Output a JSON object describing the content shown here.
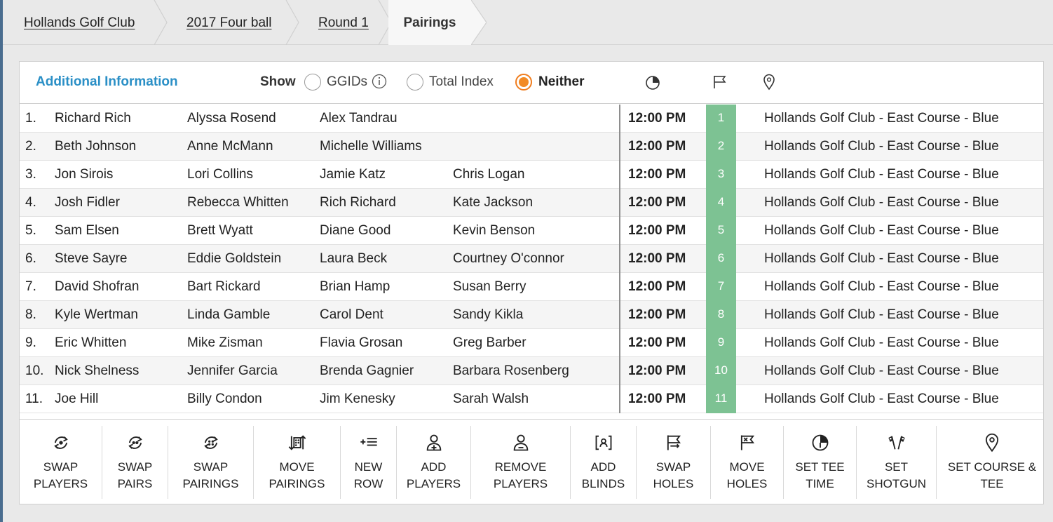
{
  "breadcrumb": [
    "Hollands Golf Club",
    "2017 Four ball",
    "Round 1",
    "Pairings"
  ],
  "info": {
    "title": "Additional Information",
    "show_label": "Show",
    "options": [
      "GGIDs",
      "Total Index",
      "Neither"
    ],
    "selected": "Neither"
  },
  "header_icons": [
    "clock-icon",
    "flag-icon",
    "location-pin-icon"
  ],
  "accent_colors": {
    "title": "#2a8fc6",
    "radio_selected": "#f28a24",
    "hole_cell": "#7dc293"
  },
  "rows": [
    {
      "num": "1.",
      "players": [
        "Richard Rich",
        "Alyssa Rosend",
        "Alex Tandrau",
        ""
      ],
      "time": "12:00 PM",
      "hole": "1",
      "course": "Hollands Golf Club - East Course - Blue"
    },
    {
      "num": "2.",
      "players": [
        "Beth Johnson",
        "Anne McMann",
        "Michelle Williams",
        ""
      ],
      "time": "12:00 PM",
      "hole": "2",
      "course": "Hollands Golf Club - East Course - Blue"
    },
    {
      "num": "3.",
      "players": [
        "Jon Sirois",
        "Lori Collins",
        "Jamie Katz",
        "Chris Logan"
      ],
      "time": "12:00 PM",
      "hole": "3",
      "course": "Hollands Golf Club - East Course - Blue"
    },
    {
      "num": "4.",
      "players": [
        "Josh Fidler",
        "Rebecca Whitten",
        "Rich Richard",
        "Kate Jackson"
      ],
      "time": "12:00 PM",
      "hole": "4",
      "course": "Hollands Golf Club - East Course - Blue"
    },
    {
      "num": "5.",
      "players": [
        "Sam Elsen",
        "Brett Wyatt",
        "Diane Good",
        "Kevin Benson"
      ],
      "time": "12:00 PM",
      "hole": "5",
      "course": "Hollands Golf Club - East Course - Blue"
    },
    {
      "num": "6.",
      "players": [
        "Steve Sayre",
        "Eddie Goldstein",
        "Laura Beck",
        "Courtney O'connor"
      ],
      "time": "12:00 PM",
      "hole": "6",
      "course": "Hollands Golf Club - East Course - Blue"
    },
    {
      "num": "7.",
      "players": [
        "David Shofran",
        "Bart Rickard",
        "Brian Hamp",
        "Susan Berry"
      ],
      "time": "12:00 PM",
      "hole": "7",
      "course": "Hollands Golf Club - East Course - Blue"
    },
    {
      "num": "8.",
      "players": [
        "Kyle Wertman",
        "Linda Gamble",
        "Carol Dent",
        "Sandy Kikla"
      ],
      "time": "12:00 PM",
      "hole": "8",
      "course": "Hollands Golf Club - East Course - Blue"
    },
    {
      "num": "9.",
      "players": [
        "Eric Whitten",
        "Mike Zisman",
        "Flavia Grosan",
        "Greg Barber"
      ],
      "time": "12:00 PM",
      "hole": "9",
      "course": "Hollands Golf Club - East Course - Blue"
    },
    {
      "num": "10.",
      "players": [
        "Nick Shelness",
        "Jennifer Garcia",
        "Brenda Gagnier",
        "Barbara Rosenberg"
      ],
      "time": "12:00 PM",
      "hole": "10",
      "course": "Hollands Golf Club - East Course - Blue"
    },
    {
      "num": "11.",
      "players": [
        "Joe Hill",
        "Billy Condon",
        "Jim Kenesky",
        "Sarah Walsh"
      ],
      "time": "12:00 PM",
      "hole": "11",
      "course": "Hollands Golf Club - East Course - Blue"
    }
  ],
  "tools": [
    {
      "id": "swap-players",
      "label": "SWAP\nPLAYERS",
      "icon": "swap-players-icon"
    },
    {
      "id": "swap-pairs",
      "label": "SWAP\nPAIRS",
      "icon": "swap-pairs-icon"
    },
    {
      "id": "swap-pairings",
      "label": "SWAP\nPAIRINGS",
      "icon": "swap-pairings-icon"
    },
    {
      "id": "move-pairings",
      "label": "MOVE\nPAIRINGS",
      "icon": "move-pairings-icon"
    },
    {
      "id": "new-row",
      "label": "NEW\nROW",
      "icon": "new-row-icon"
    },
    {
      "id": "add-players",
      "label": "ADD\nPLAYERS",
      "icon": "add-player-icon"
    },
    {
      "id": "remove-players",
      "label": "REMOVE\nPLAYERS",
      "icon": "remove-player-icon"
    },
    {
      "id": "add-blinds",
      "label": "ADD\nBLINDS",
      "icon": "blind-icon"
    },
    {
      "id": "swap-holes",
      "label": "SWAP\nHOLES",
      "icon": "swap-holes-icon"
    },
    {
      "id": "move-holes",
      "label": "MOVE\nHOLES",
      "icon": "move-holes-icon"
    },
    {
      "id": "set-tee-time",
      "label": "SET TEE\nTIME",
      "icon": "clock-icon"
    },
    {
      "id": "set-shotgun",
      "label": "SET\nSHOTGUN",
      "icon": "checkered-flags-icon"
    },
    {
      "id": "set-course-tee",
      "label": "SET COURSE &\nTEE",
      "icon": "location-pin-icon"
    }
  ]
}
